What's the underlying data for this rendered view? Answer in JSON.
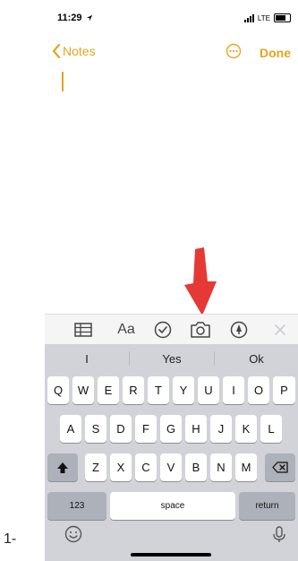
{
  "step_label": "1-",
  "status_bar": {
    "time": "11:29",
    "network": "LTE"
  },
  "nav": {
    "back_label": "Notes",
    "done_label": "Done"
  },
  "toolbar": {
    "format_label": "Aa"
  },
  "keyboard": {
    "suggestions": [
      "I",
      "Yes",
      "Ok"
    ],
    "row1": [
      "Q",
      "W",
      "E",
      "R",
      "T",
      "Y",
      "U",
      "I",
      "O",
      "P"
    ],
    "row2": [
      "A",
      "S",
      "D",
      "F",
      "G",
      "H",
      "J",
      "K",
      "L"
    ],
    "row3": [
      "Z",
      "X",
      "C",
      "V",
      "B",
      "N",
      "M"
    ],
    "numbers_label": "123",
    "space_label": "space",
    "return_label": "return"
  },
  "colors": {
    "accent": "#e2a61b",
    "arrow": "#e53935",
    "keyboard_bg": "#d1d3d9"
  },
  "icons": [
    "location-arrow-icon",
    "signal-icon",
    "battery-icon",
    "chevron-left-icon",
    "more-icon",
    "table-icon",
    "checklist-icon",
    "camera-icon",
    "markup-icon",
    "close-icon",
    "shift-icon",
    "backspace-icon",
    "emoji-icon",
    "microphone-icon",
    "red-arrow-icon"
  ]
}
